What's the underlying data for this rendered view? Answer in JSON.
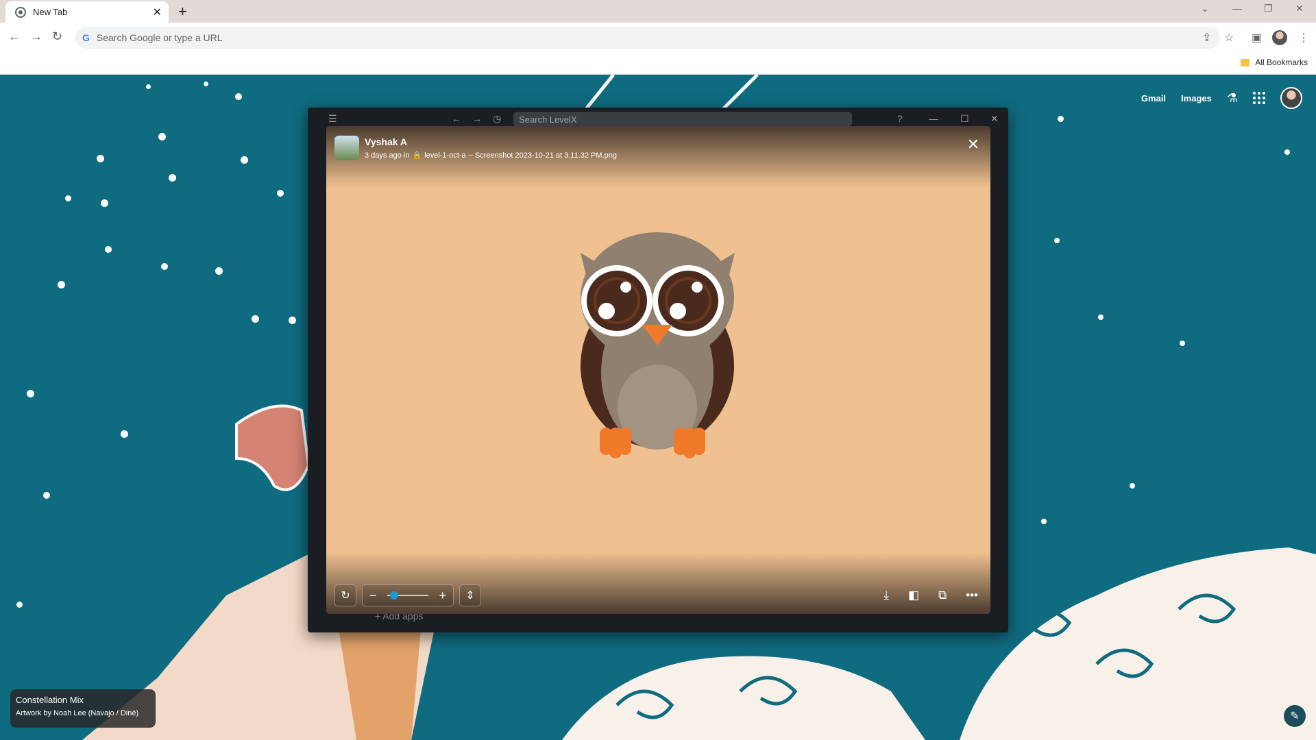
{
  "browser": {
    "tab_title": "New Tab",
    "omnibox_placeholder": "Search Google or type a URL",
    "bookmarks_folder": "All Bookmarks"
  },
  "ntp": {
    "links": [
      "Gmail",
      "Images"
    ],
    "attribution_title": "Constellation Mix",
    "attribution_artist": "Artwork by Noah Lee (Navajo / Diné)"
  },
  "app": {
    "search_placeholder": "Search LevelX",
    "add_apps": "Add apps"
  },
  "viewer": {
    "user_name": "Vyshak A",
    "time": "3 days ago in",
    "channel": "level-1-oct-a",
    "filename": "– Screenshot 2023-10-21 at 3.11.32 PM.png",
    "zoom_level": 0.1
  }
}
